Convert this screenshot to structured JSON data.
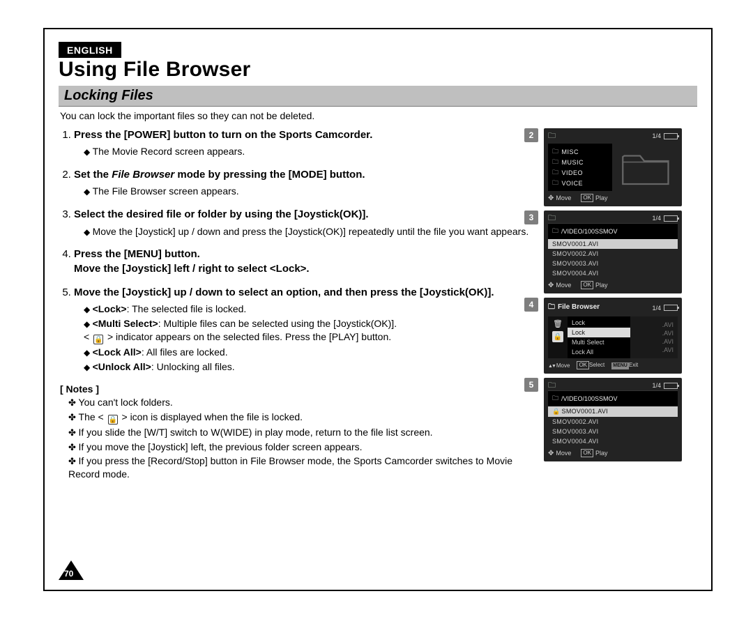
{
  "lang_badge": "ENGLISH",
  "title": "Using File Browser",
  "section": "Locking Files",
  "intro": "You can lock the important files so they can not be deleted.",
  "steps": {
    "s1": {
      "head": "Press the [POWER] button to turn on the Sports Camcorder.",
      "b1": "The Movie Record screen appears."
    },
    "s2": {
      "head_a": "Set the ",
      "head_em": "File Browser",
      "head_b": " mode by pressing the [MODE] button.",
      "b1": "The File Browser screen appears."
    },
    "s3": {
      "head": "Select the desired file or folder by using the [Joystick(OK)].",
      "b1": "Move the [Joystick] up / down and press the [Joystick(OK)] repeatedly until the file you want appears."
    },
    "s4": {
      "head_a": "Press the [MENU] button.",
      "head_b": "Move the [Joystick] left / right to select <Lock>."
    },
    "s5": {
      "head": "Move the [Joystick] up / down to select an option, and then press the [Joystick(OK)].",
      "b1_lead": "<Lock>",
      "b1_rest": ": The selected file is locked.",
      "b2_lead": "<Multi Select>",
      "b2_rest": ": Multiple files can be selected using the [Joystick(OK)].",
      "b2_line2a": "< ",
      "b2_line2b": " > indicator appears on the selected files. Press the [PLAY] button.",
      "b3_lead": "<Lock All>",
      "b3_rest": ": All files are locked.",
      "b4_lead": "<Unlock All>",
      "b4_rest": ": Unlocking all files."
    }
  },
  "notes_head": "[ Notes ]",
  "notes": {
    "n1": "You can't lock folders.",
    "n2a": "The < ",
    "n2b": " > icon is displayed when the file is locked.",
    "n3": "If you slide the [W/T] switch to W(WIDE) in play mode, return to the file list screen.",
    "n4": "If you move the [Joystick] left, the previous folder screen appears.",
    "n5": "If you press the [Record/Stop] button in File Browser mode, the Sports Camcorder switches to Movie Record mode."
  },
  "page_num": "70",
  "shots": {
    "s2": {
      "badge": "2",
      "page": "1/4",
      "folders": [
        "MISC",
        "MUSIC",
        "VIDEO",
        "VOICE"
      ],
      "move": "Move",
      "play": "Play"
    },
    "s3": {
      "badge": "3",
      "page": "1/4",
      "path": "/VIDEO/100SSMOV",
      "files": [
        "SMOV0001.AVI",
        "SMOV0002.AVI",
        "SMOV0003.AVI",
        "SMOV0004.AVI"
      ],
      "move": "Move",
      "play": "Play"
    },
    "s4": {
      "badge": "4",
      "title": "File Browser",
      "page": "1/4",
      "group": "Lock",
      "menu": [
        "Lock",
        "Multi Select",
        "Lock All"
      ],
      "ghost": [
        ".AVI",
        ".AVI",
        ".AVI",
        ".AVI"
      ],
      "move": "Move",
      "select": "Select",
      "exit": "Exit"
    },
    "s5": {
      "badge": "5",
      "page": "1/4",
      "path": "/VIDEO/100SSMOV",
      "files": [
        "SMOV0001.AVI",
        "SMOV0002.AVI",
        "SMOV0003.AVI",
        "SMOV0004.AVI"
      ],
      "move": "Move",
      "play": "Play"
    }
  }
}
